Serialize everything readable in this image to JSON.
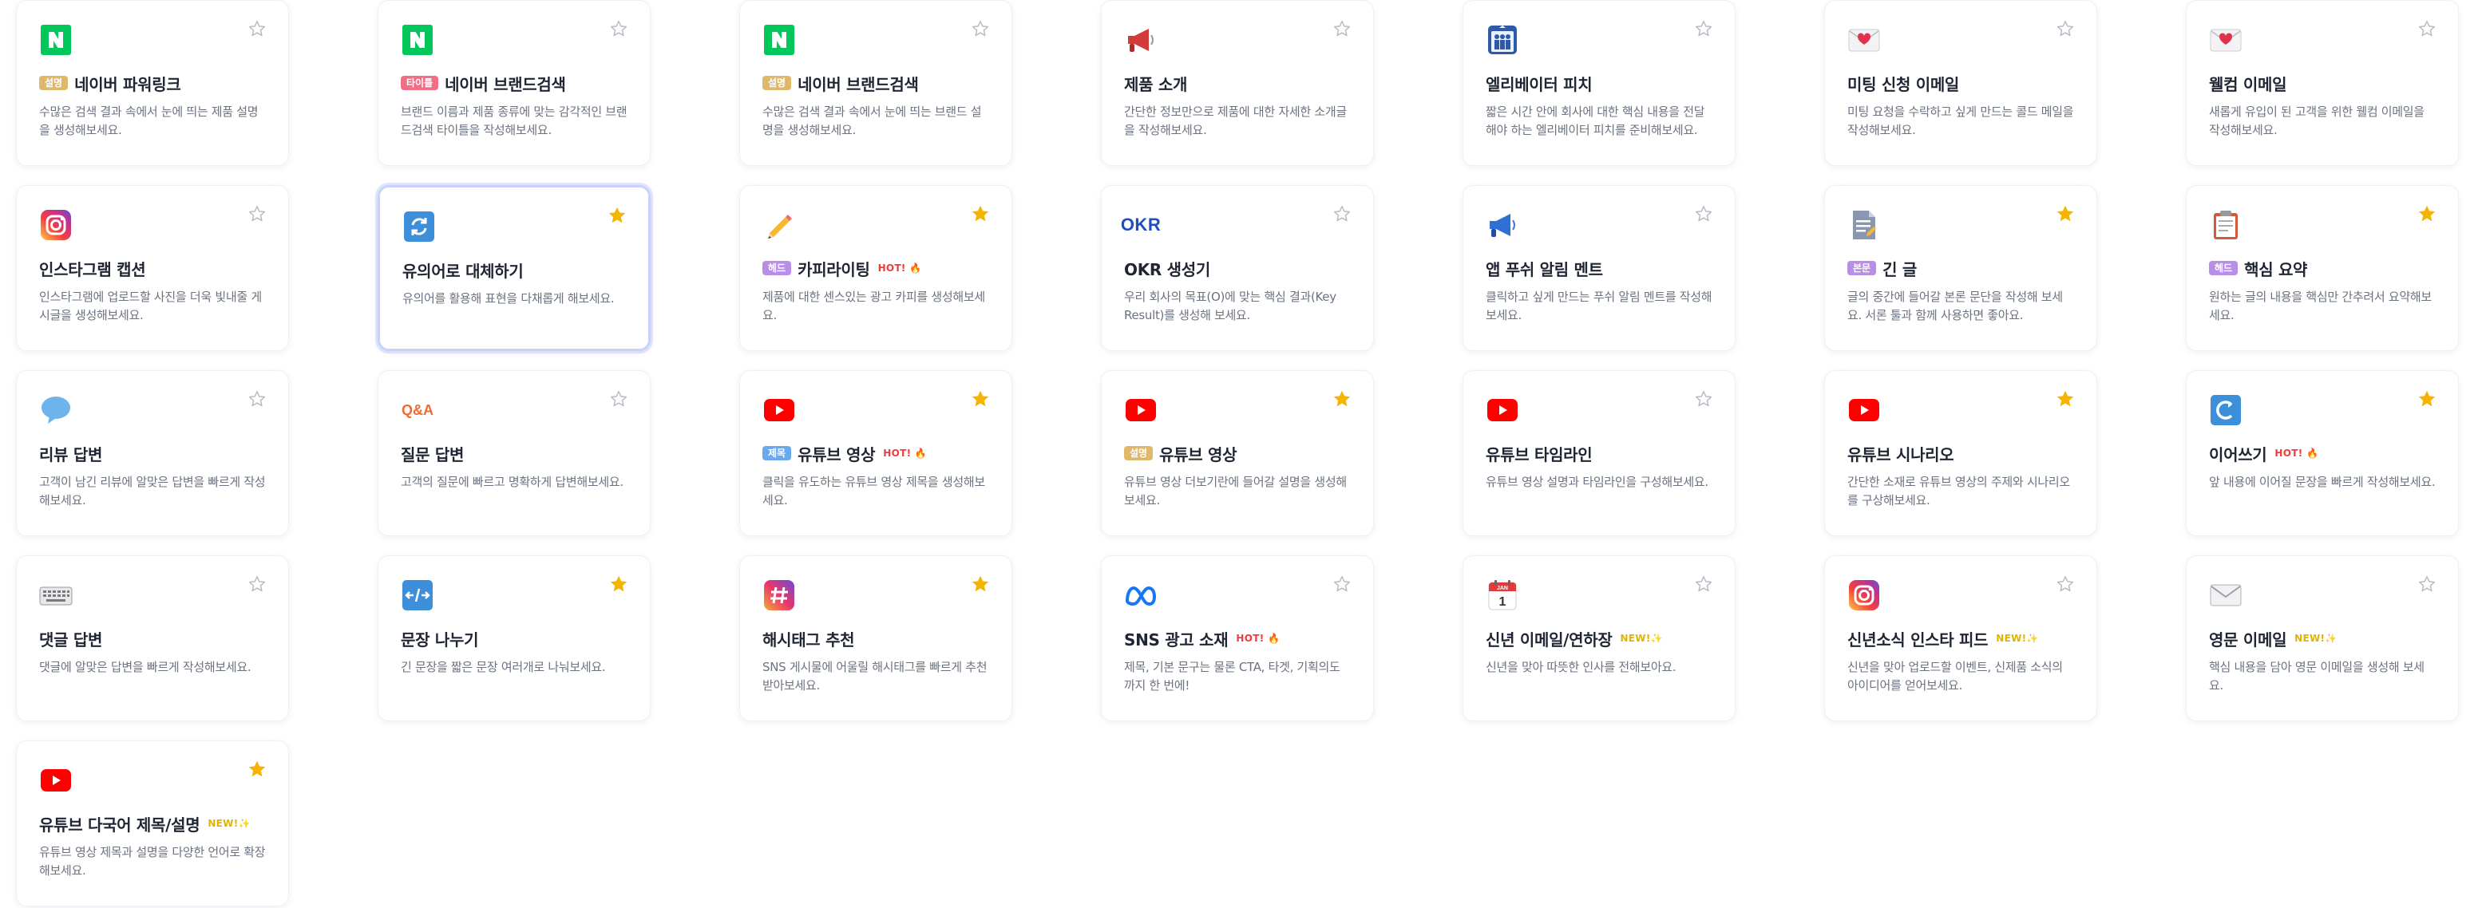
{
  "colors": {
    "star_on": "#f5b400",
    "star_off": "#b8bcc4",
    "tag_gold": "#e0b86a",
    "tag_pink": "#ee6f86",
    "tag_purple": "#b98ee6",
    "tag_blue": "#6aa9ee",
    "hot": "#ef3b3b",
    "new": "#e0b400"
  },
  "cards": [
    {
      "name": "card-naver-powerlink",
      "icon": "naver-n-icon",
      "tag": "설명",
      "tag_color": "gold",
      "title": "네이버 파워링크",
      "badge": "",
      "desc": "수많은 검색 결과 속에서 눈에 띄는 제품 설명을 생성해보세요.",
      "starred": false,
      "selected": false
    },
    {
      "name": "card-naver-brand-title",
      "icon": "naver-n-icon",
      "tag": "타이틀",
      "tag_color": "pink",
      "title": "네이버 브랜드검색",
      "badge": "",
      "desc": "브랜드 이름과 제품 종류에 맞는 감각적인 브랜드검색 타이틀을 작성해보세요.",
      "starred": false,
      "selected": false
    },
    {
      "name": "card-naver-brand-desc",
      "icon": "naver-n-icon",
      "tag": "설명",
      "tag_color": "gold",
      "title": "네이버 브랜드검색",
      "badge": "",
      "desc": "수많은 검색 결과 속에서 눈에 띄는 브랜드 설명을 생성해보세요.",
      "starred": false,
      "selected": false
    },
    {
      "name": "card-product-intro",
      "icon": "megaphone-icon",
      "tag": "",
      "tag_color": "",
      "title": "제품 소개",
      "badge": "",
      "desc": "간단한 정보만으로 제품에 대한 자세한 소개글을 작성해보세요.",
      "starred": false,
      "selected": false
    },
    {
      "name": "card-elevator-pitch",
      "icon": "elevator-icon",
      "tag": "",
      "tag_color": "",
      "title": "엘리베이터 피치",
      "badge": "",
      "desc": "짧은 시간 안에 회사에 대한 핵심 내용을 전달해야 하는 엘리베이터 피치를 준비해보세요.",
      "starred": false,
      "selected": false
    },
    {
      "name": "card-meeting-email",
      "icon": "love-letter-icon",
      "tag": "",
      "tag_color": "",
      "title": "미팅 신청 이메일",
      "badge": "",
      "desc": "미팅 요청을 수락하고 싶게 만드는 콜드 메일을 작성해보세요.",
      "starred": false,
      "selected": false
    },
    {
      "name": "card-welcome-email",
      "icon": "love-letter-icon",
      "tag": "",
      "tag_color": "",
      "title": "웰컴 이메일",
      "badge": "",
      "desc": "새롭게 유입이 된 고객을 위한 웰컴 이메일을 작성해보세요.",
      "starred": false,
      "selected": false
    },
    {
      "name": "card-instagram-caption",
      "icon": "instagram-icon",
      "tag": "",
      "tag_color": "",
      "title": "인스타그램 캡션",
      "badge": "",
      "desc": "인스타그램에 업로드할 사진을 더욱 빛내줄 게시글을 생성해보세요.",
      "starred": false,
      "selected": false
    },
    {
      "name": "card-synonym-replace",
      "icon": "refresh-icon",
      "tag": "",
      "tag_color": "",
      "title": "유의어로 대체하기",
      "badge": "",
      "desc": "유의어를 활용해 표현을 다채롭게 해보세요.",
      "starred": true,
      "selected": true
    },
    {
      "name": "card-copywriting",
      "icon": "pencil-icon",
      "tag": "헤드",
      "tag_color": "purple",
      "title": "카피라이팅",
      "badge": "HOT! 🔥",
      "badge_type": "hot",
      "desc": "제품에 대한 센스있는 광고 카피를 생성해보세요.",
      "starred": true,
      "selected": false
    },
    {
      "name": "card-okr",
      "icon": "okr-icon",
      "icon_text": "OKR",
      "tag": "",
      "tag_color": "",
      "title": "OKR 생성기",
      "badge": "",
      "desc": "우리 회사의 목표(O)에 맞는 핵심 결과(Key Result)를 생성해 보세요.",
      "starred": false,
      "selected": false
    },
    {
      "name": "card-app-push",
      "icon": "megaphone-blue-icon",
      "tag": "",
      "tag_color": "",
      "title": "앱 푸쉬 알림 멘트",
      "badge": "",
      "desc": "클릭하고 싶게 만드는 푸쉬 알림 멘트를 작성해 보세요.",
      "starred": false,
      "selected": false
    },
    {
      "name": "card-long-text",
      "icon": "document-icon",
      "tag": "본문",
      "tag_color": "purple",
      "title": "긴 글",
      "badge": "",
      "desc": "글의 중간에 들어갈 본론 문단을 작성해 보세요. 서론 툴과 함께 사용하면 좋아요.",
      "starred": true,
      "selected": false
    },
    {
      "name": "card-key-summary",
      "icon": "clipboard-icon",
      "tag": "헤드",
      "tag_color": "purple",
      "title": "핵심 요약",
      "badge": "",
      "desc": "원하는 글의 내용을 핵심만 간추려서 요약해보세요.",
      "starred": true,
      "selected": false
    },
    {
      "name": "card-review-reply",
      "icon": "speech-bubble-icon",
      "tag": "",
      "tag_color": "",
      "title": "리뷰 답변",
      "badge": "",
      "desc": "고객이 남긴 리뷰에 알맞은 답변을 빠르게 작성해보세요.",
      "starred": false,
      "selected": false
    },
    {
      "name": "card-qna-reply",
      "icon": "qna-icon",
      "icon_text": "Q&A",
      "tag": "",
      "tag_color": "",
      "title": "질문 답변",
      "badge": "",
      "desc": "고객의 질문에 빠르고 명확하게 답변해보세요.",
      "starred": false,
      "selected": false
    },
    {
      "name": "card-youtube-title",
      "icon": "youtube-icon",
      "tag": "제목",
      "tag_color": "blue",
      "title": "유튜브 영상",
      "badge": "HOT! 🔥",
      "badge_type": "hot",
      "desc": "클릭을 유도하는 유튜브 영상 제목을 생성해보세요.",
      "starred": true,
      "selected": false
    },
    {
      "name": "card-youtube-desc",
      "icon": "youtube-icon",
      "tag": "설명",
      "tag_color": "gold",
      "title": "유튜브 영상",
      "badge": "",
      "desc": "유튜브 영상 더보기란에 들어갈 설명을 생성해 보세요.",
      "starred": true,
      "selected": false
    },
    {
      "name": "card-youtube-timeline",
      "icon": "youtube-icon",
      "tag": "",
      "tag_color": "",
      "title": "유튜브 타임라인",
      "badge": "",
      "desc": "유튜브 영상 설명과 타임라인을 구성해보세요.",
      "starred": false,
      "selected": false
    },
    {
      "name": "card-youtube-scenario",
      "icon": "youtube-icon",
      "tag": "",
      "tag_color": "",
      "title": "유튜브 시나리오",
      "badge": "",
      "desc": "간단한 소재로 유튜브 영상의 주제와 시나리오를 구상해보세요.",
      "starred": true,
      "selected": false
    },
    {
      "name": "card-continue-writing",
      "icon": "continue-icon",
      "tag": "",
      "tag_color": "",
      "title": "이어쓰기",
      "badge": "HOT! 🔥",
      "badge_type": "hot",
      "desc": "앞 내용에 이어질 문장을 빠르게 작성해보세요.",
      "starred": true,
      "selected": false
    },
    {
      "name": "card-comment-reply",
      "icon": "keyboard-icon",
      "tag": "",
      "tag_color": "",
      "title": "댓글 답변",
      "badge": "",
      "desc": "댓글에 알맞은 답변을 빠르게 작성해보세요.",
      "starred": false,
      "selected": false
    },
    {
      "name": "card-split-sentence",
      "icon": "split-icon",
      "tag": "",
      "tag_color": "",
      "title": "문장 나누기",
      "badge": "",
      "desc": "긴 문장을 짧은 문장 여러개로 나눠보세요.",
      "starred": true,
      "selected": false
    },
    {
      "name": "card-hashtag",
      "icon": "hashtag-icon",
      "tag": "",
      "tag_color": "",
      "title": "해시태그 추천",
      "badge": "",
      "desc": "SNS 게시물에 어울릴 해시태그를 빠르게 추천받아보세요.",
      "starred": true,
      "selected": false
    },
    {
      "name": "card-sns-ad",
      "icon": "meta-icon",
      "tag": "",
      "tag_color": "",
      "title": "SNS 광고 소재",
      "badge": "HOT! 🔥",
      "badge_type": "hot",
      "desc": "제목, 기본 문구는 물론 CTA, 타겟, 기획의도까지 한 번에!",
      "starred": false,
      "selected": false
    },
    {
      "name": "card-newyear-email",
      "icon": "calendar-icon",
      "tag": "",
      "tag_color": "",
      "title": "신년 이메일/연하장",
      "badge": "NEW!✨",
      "badge_type": "new",
      "desc": "신년을 맞아 따뜻한 인사를 전해보아요.",
      "starred": false,
      "selected": false
    },
    {
      "name": "card-newyear-insta",
      "icon": "instagram-icon",
      "tag": "",
      "tag_color": "",
      "title": "신년소식 인스타 피드",
      "badge": "NEW!✨",
      "badge_type": "new",
      "desc": "신년을 맞아 업로드할 이벤트, 신제품 소식의 아이디어를 얻어보세요.",
      "starred": false,
      "selected": false
    },
    {
      "name": "card-english-email",
      "icon": "envelope-icon",
      "tag": "",
      "tag_color": "",
      "title": "영문 이메일",
      "badge": "NEW!✨",
      "badge_type": "new",
      "desc": "핵심 내용을 담아 영문 이메일을 생성해 보세요.",
      "starred": false,
      "selected": false
    },
    {
      "name": "card-youtube-multilang",
      "icon": "youtube-icon",
      "tag": "",
      "tag_color": "",
      "title": "유튜브 다국어 제목/설명",
      "badge": "NEW!✨",
      "badge_type": "new",
      "desc": "유튜브 영상 제목과 설명을 다양한 언어로 확장해보세요.",
      "starred": true,
      "selected": false
    }
  ]
}
